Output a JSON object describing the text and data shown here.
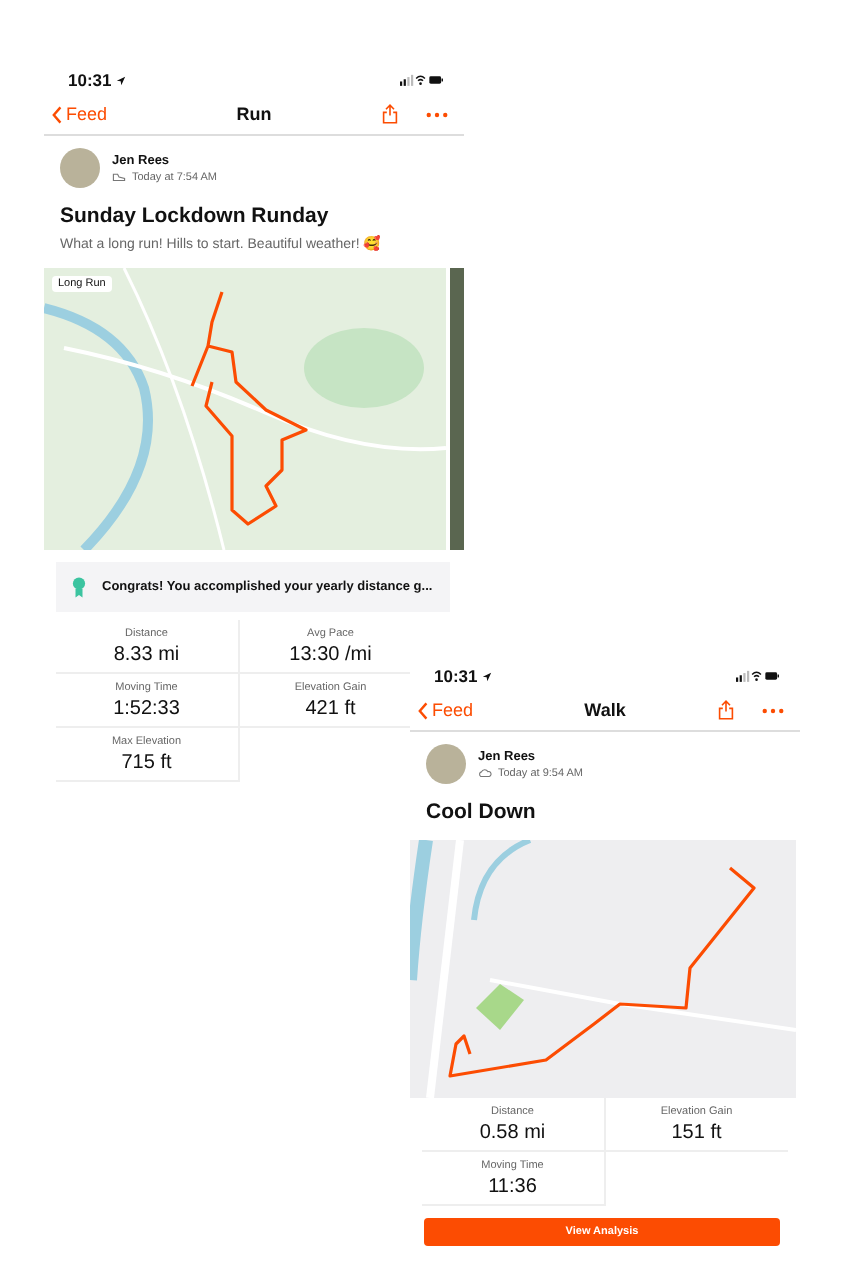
{
  "screens": [
    {
      "kind": "run",
      "status_time": "10:31",
      "back": "Feed",
      "title": "Run",
      "author": "Jen Rees",
      "timestamp": "Today at 7:54 AM",
      "activity_title": "Sunday Lockdown Runday",
      "description": "What a long run! Hills to start. Beautiful weather! 🥰",
      "map_label": "Long Run",
      "achievement": "Congrats! You accomplished your yearly distance g...",
      "stats": [
        {
          "label": "Distance",
          "value": "8.33 mi"
        },
        {
          "label": "Avg Pace",
          "value": "13:30 /mi"
        },
        {
          "label": "Moving Time",
          "value": "1:52:33"
        },
        {
          "label": "Elevation Gain",
          "value": "421 ft"
        },
        {
          "label": "Max Elevation",
          "value": "715 ft"
        }
      ]
    },
    {
      "kind": "walk",
      "status_time": "10:31",
      "back": "Feed",
      "title": "Walk",
      "author": "Jen Rees",
      "timestamp": "Today at 9:54 AM",
      "activity_title": "Cool Down",
      "stats": [
        {
          "label": "Distance",
          "value": "0.58 mi"
        },
        {
          "label": "Elevation Gain",
          "value": "151 ft"
        },
        {
          "label": "Moving Time",
          "value": "11:36"
        }
      ],
      "button": "View Analysis"
    }
  ]
}
